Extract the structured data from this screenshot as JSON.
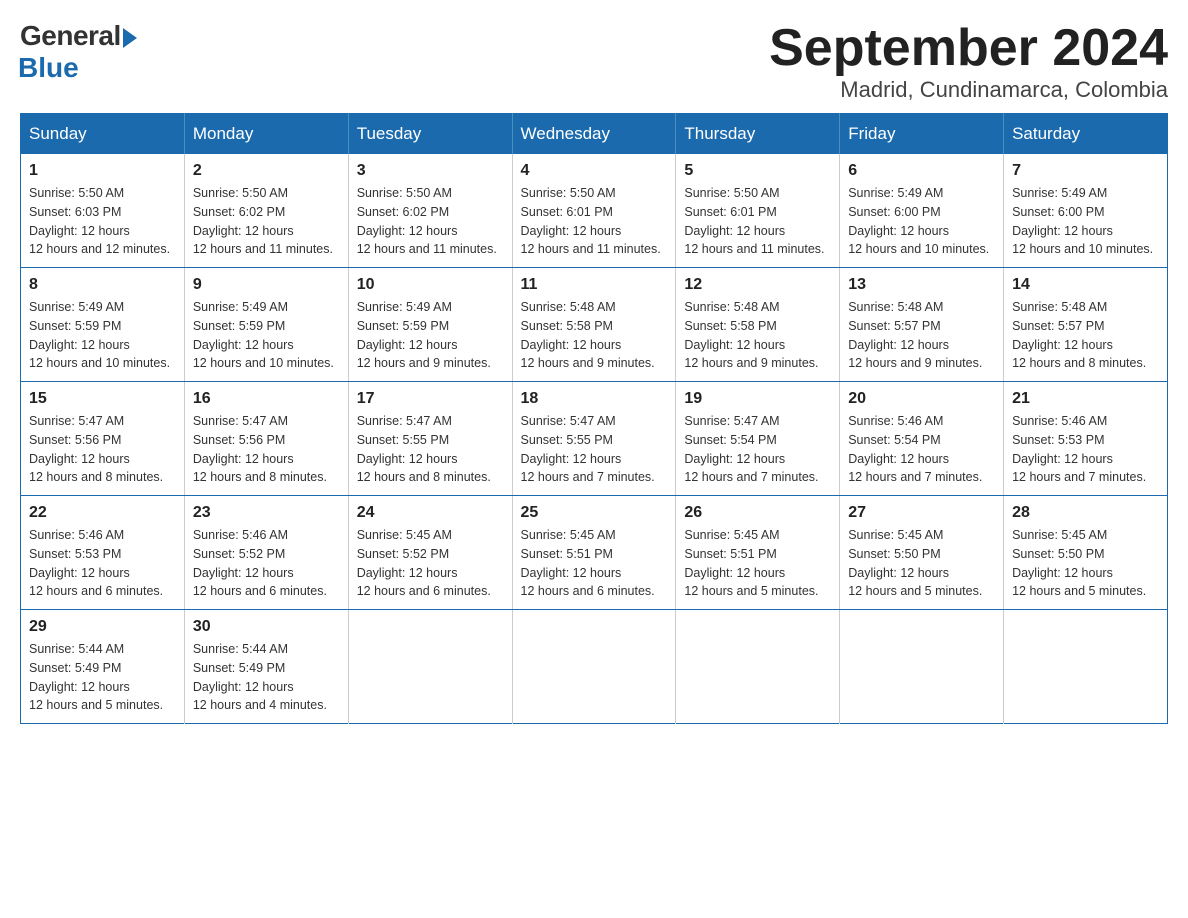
{
  "logo": {
    "general": "General",
    "blue": "Blue"
  },
  "title": "September 2024",
  "location": "Madrid, Cundinamarca, Colombia",
  "headers": [
    "Sunday",
    "Monday",
    "Tuesday",
    "Wednesday",
    "Thursday",
    "Friday",
    "Saturday"
  ],
  "weeks": [
    [
      {
        "day": "1",
        "sunrise": "5:50 AM",
        "sunset": "6:03 PM",
        "daylight": "12 hours and 12 minutes."
      },
      {
        "day": "2",
        "sunrise": "5:50 AM",
        "sunset": "6:02 PM",
        "daylight": "12 hours and 11 minutes."
      },
      {
        "day": "3",
        "sunrise": "5:50 AM",
        "sunset": "6:02 PM",
        "daylight": "12 hours and 11 minutes."
      },
      {
        "day": "4",
        "sunrise": "5:50 AM",
        "sunset": "6:01 PM",
        "daylight": "12 hours and 11 minutes."
      },
      {
        "day": "5",
        "sunrise": "5:50 AM",
        "sunset": "6:01 PM",
        "daylight": "12 hours and 11 minutes."
      },
      {
        "day": "6",
        "sunrise": "5:49 AM",
        "sunset": "6:00 PM",
        "daylight": "12 hours and 10 minutes."
      },
      {
        "day": "7",
        "sunrise": "5:49 AM",
        "sunset": "6:00 PM",
        "daylight": "12 hours and 10 minutes."
      }
    ],
    [
      {
        "day": "8",
        "sunrise": "5:49 AM",
        "sunset": "5:59 PM",
        "daylight": "12 hours and 10 minutes."
      },
      {
        "day": "9",
        "sunrise": "5:49 AM",
        "sunset": "5:59 PM",
        "daylight": "12 hours and 10 minutes."
      },
      {
        "day": "10",
        "sunrise": "5:49 AM",
        "sunset": "5:59 PM",
        "daylight": "12 hours and 9 minutes."
      },
      {
        "day": "11",
        "sunrise": "5:48 AM",
        "sunset": "5:58 PM",
        "daylight": "12 hours and 9 minutes."
      },
      {
        "day": "12",
        "sunrise": "5:48 AM",
        "sunset": "5:58 PM",
        "daylight": "12 hours and 9 minutes."
      },
      {
        "day": "13",
        "sunrise": "5:48 AM",
        "sunset": "5:57 PM",
        "daylight": "12 hours and 9 minutes."
      },
      {
        "day": "14",
        "sunrise": "5:48 AM",
        "sunset": "5:57 PM",
        "daylight": "12 hours and 8 minutes."
      }
    ],
    [
      {
        "day": "15",
        "sunrise": "5:47 AM",
        "sunset": "5:56 PM",
        "daylight": "12 hours and 8 minutes."
      },
      {
        "day": "16",
        "sunrise": "5:47 AM",
        "sunset": "5:56 PM",
        "daylight": "12 hours and 8 minutes."
      },
      {
        "day": "17",
        "sunrise": "5:47 AM",
        "sunset": "5:55 PM",
        "daylight": "12 hours and 8 minutes."
      },
      {
        "day": "18",
        "sunrise": "5:47 AM",
        "sunset": "5:55 PM",
        "daylight": "12 hours and 7 minutes."
      },
      {
        "day": "19",
        "sunrise": "5:47 AM",
        "sunset": "5:54 PM",
        "daylight": "12 hours and 7 minutes."
      },
      {
        "day": "20",
        "sunrise": "5:46 AM",
        "sunset": "5:54 PM",
        "daylight": "12 hours and 7 minutes."
      },
      {
        "day": "21",
        "sunrise": "5:46 AM",
        "sunset": "5:53 PM",
        "daylight": "12 hours and 7 minutes."
      }
    ],
    [
      {
        "day": "22",
        "sunrise": "5:46 AM",
        "sunset": "5:53 PM",
        "daylight": "12 hours and 6 minutes."
      },
      {
        "day": "23",
        "sunrise": "5:46 AM",
        "sunset": "5:52 PM",
        "daylight": "12 hours and 6 minutes."
      },
      {
        "day": "24",
        "sunrise": "5:45 AM",
        "sunset": "5:52 PM",
        "daylight": "12 hours and 6 minutes."
      },
      {
        "day": "25",
        "sunrise": "5:45 AM",
        "sunset": "5:51 PM",
        "daylight": "12 hours and 6 minutes."
      },
      {
        "day": "26",
        "sunrise": "5:45 AM",
        "sunset": "5:51 PM",
        "daylight": "12 hours and 5 minutes."
      },
      {
        "day": "27",
        "sunrise": "5:45 AM",
        "sunset": "5:50 PM",
        "daylight": "12 hours and 5 minutes."
      },
      {
        "day": "28",
        "sunrise": "5:45 AM",
        "sunset": "5:50 PM",
        "daylight": "12 hours and 5 minutes."
      }
    ],
    [
      {
        "day": "29",
        "sunrise": "5:44 AM",
        "sunset": "5:49 PM",
        "daylight": "12 hours and 5 minutes."
      },
      {
        "day": "30",
        "sunrise": "5:44 AM",
        "sunset": "5:49 PM",
        "daylight": "12 hours and 4 minutes."
      },
      null,
      null,
      null,
      null,
      null
    ]
  ]
}
